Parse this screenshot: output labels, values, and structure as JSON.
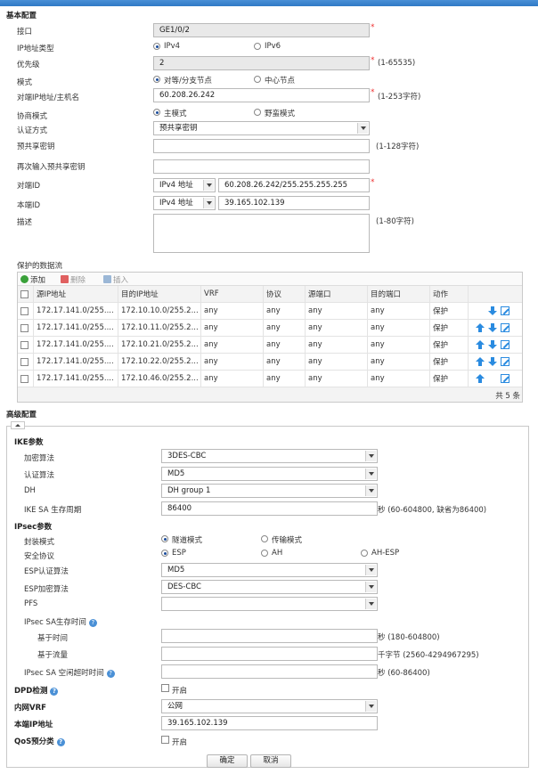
{
  "basic": {
    "title": "基本配置",
    "interface": {
      "label": "接口",
      "value": "GE1/0/2"
    },
    "ip_type": {
      "label": "IP地址类型",
      "opt1": "IPv4",
      "opt2": "IPv6"
    },
    "priority": {
      "label": "优先级",
      "value": "2",
      "hint": "(1-65535)"
    },
    "mode": {
      "label": "模式",
      "opt1": "对等/分支节点",
      "opt2": "中心节点"
    },
    "peer": {
      "label": "对端IP地址/主机名",
      "value": "60.208.26.242",
      "hint": "(1-253字符)"
    },
    "nego": {
      "label": "协商模式",
      "opt1": "主模式",
      "opt2": "野蛮模式"
    },
    "auth": {
      "label": "认证方式",
      "value": "预共享密钥"
    },
    "psk": {
      "label": "预共享密钥",
      "hint": "(1-128字符)"
    },
    "psk2": {
      "label": "再次输入预共享密钥"
    },
    "peer_id": {
      "label": "对端ID",
      "type": "IPv4 地址",
      "value": "60.208.26.242/255.255.255.255"
    },
    "local_id": {
      "label": "本端ID",
      "type": "IPv4 地址",
      "value": "39.165.102.139"
    },
    "desc": {
      "label": "描述",
      "hint": "(1-80字符)"
    }
  },
  "flows": {
    "title": "保护的数据流",
    "toolbar": {
      "add": "添加",
      "delete": "删除",
      "insert": "插入"
    },
    "headers": [
      "源IP地址",
      "目的IP地址",
      "VRF",
      "协议",
      "源端口",
      "目的端口",
      "动作"
    ],
    "rows": [
      [
        "172.17.141.0/255....",
        "172.10.10.0/255.2...",
        "any",
        "any",
        "any",
        "any",
        "保护"
      ],
      [
        "172.17.141.0/255....",
        "172.10.11.0/255.2...",
        "any",
        "any",
        "any",
        "any",
        "保护"
      ],
      [
        "172.17.141.0/255....",
        "172.10.21.0/255.2...",
        "any",
        "any",
        "any",
        "any",
        "保护"
      ],
      [
        "172.17.141.0/255....",
        "172.10.22.0/255.2...",
        "any",
        "any",
        "any",
        "any",
        "保护"
      ],
      [
        "172.17.141.0/255....",
        "172.10.46.0/255.2...",
        "any",
        "any",
        "any",
        "any",
        "保护"
      ]
    ],
    "total": "共 5 条"
  },
  "advanced": {
    "title": "高级配置",
    "ike": {
      "title": "IKE参数",
      "enc": {
        "label": "加密算法",
        "value": "3DES-CBC"
      },
      "auth": {
        "label": "认证算法",
        "value": "MD5"
      },
      "dh": {
        "label": "DH",
        "value": "DH group 1"
      },
      "life": {
        "label": "IKE SA 生存周期",
        "value": "86400",
        "hint": "秒 (60-604800, 缺省为86400)"
      }
    },
    "ipsec": {
      "title": "IPsec参数",
      "encap": {
        "label": "封装模式",
        "opt1": "隧道模式",
        "opt2": "传输模式"
      },
      "proto": {
        "label": "安全协议",
        "opt1": "ESP",
        "opt2": "AH",
        "opt3": "AH-ESP"
      },
      "esp_auth": {
        "label": "ESP认证算法",
        "value": "MD5"
      },
      "esp_enc": {
        "label": "ESP加密算法",
        "value": "DES-CBC"
      },
      "pfs": {
        "label": "PFS",
        "value": ""
      },
      "sa_life": {
        "label": "IPsec SA生存时间"
      },
      "time": {
        "label": "基于时间",
        "hint": "秒 (180-604800)"
      },
      "traffic": {
        "label": "基于流量",
        "hint": "千字节 (2560-4294967295)"
      },
      "idle": {
        "label": "IPsec SA 空闲超时时间",
        "hint": "秒 (60-86400)"
      }
    },
    "dpd": {
      "label": "DPD检测",
      "check": "开启"
    },
    "vrf": {
      "label": "内网VRF",
      "value": "公网"
    },
    "local_ip": {
      "label": "本端IP地址",
      "value": "39.165.102.139"
    },
    "qos": {
      "label": "QoS预分类",
      "check": "开启"
    }
  },
  "buttons": {
    "ok": "确定",
    "cancel": "取消"
  }
}
